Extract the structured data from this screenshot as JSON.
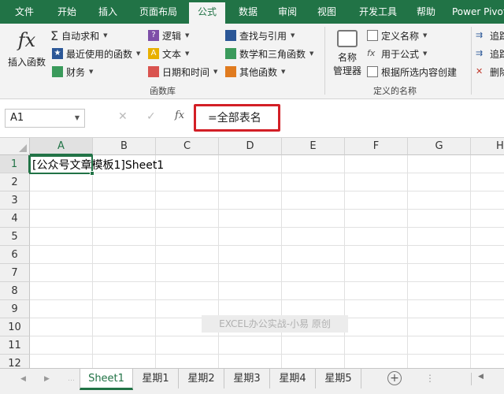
{
  "ribbon_tabs": [
    "文件",
    "开始",
    "插入",
    "页面布局",
    "公式",
    "数据",
    "审阅",
    "视图",
    "开发工具",
    "帮助",
    "Power Pivot"
  ],
  "active_tab": "公式",
  "function_library": {
    "insert_function": "插入函数",
    "autosum": "自动求和",
    "recently_used": "最近使用的函数",
    "financial": "财务",
    "logical": "逻辑",
    "text": "文本",
    "date_time": "日期和时间",
    "lookup_reference": "查找与引用",
    "math_trig": "数学和三角函数",
    "more_functions": "其他函数",
    "group_label": "函数库"
  },
  "defined_names": {
    "name_manager_line1": "名称",
    "name_manager_line2": "管理器",
    "define_name": "定义名称",
    "use_in_formula": "用于公式",
    "create_from_selection": "根据所选内容创建",
    "group_label": "定义的名称"
  },
  "formula_auditing": {
    "trace_precedents": "追踪",
    "trace_dependents": "追踪",
    "remove_arrows": "删除"
  },
  "formula_bar": {
    "name_box": "A1",
    "fx_label": "fx",
    "formula": "=全部表名"
  },
  "columns": [
    "A",
    "B",
    "C",
    "D",
    "E",
    "F",
    "G",
    "H"
  ],
  "rows": [
    "1",
    "2",
    "3",
    "4",
    "5",
    "6",
    "7",
    "8",
    "9",
    "10",
    "11",
    "12"
  ],
  "cell_a1": "[公众号文章模板1]Sheet1",
  "watermark": "EXCEL办公实战-小易 原创",
  "sheet_tabs": [
    "Sheet1",
    "星期1",
    "星期2",
    "星期3",
    "星期4",
    "星期5"
  ],
  "active_sheet": "Sheet1",
  "colors": {
    "excel_green": "#217346",
    "highlight_red": "#d31f26"
  }
}
